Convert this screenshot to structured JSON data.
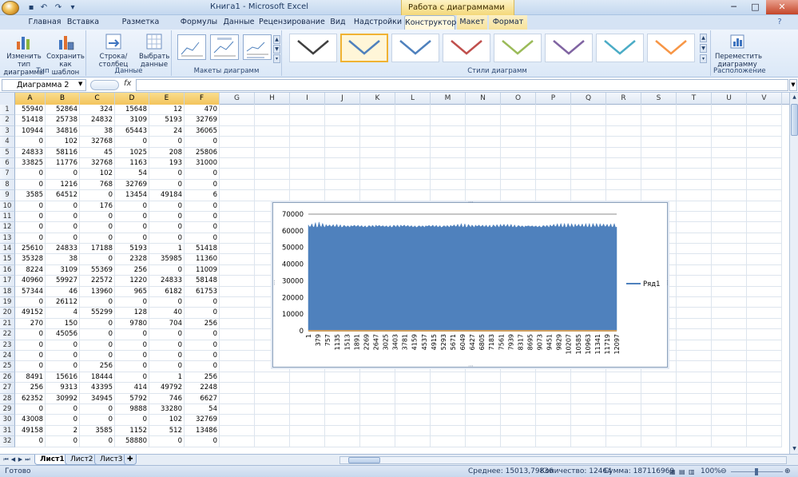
{
  "window": {
    "title": "Книга1 - Microsoft Excel",
    "context_title": "Работа с диаграммами",
    "controls": {
      "minimize": "─",
      "maximize": "□",
      "close": "✕"
    }
  },
  "ribbon_tabs": [
    "Главная",
    "Вставка",
    "Разметка страницы",
    "Формулы",
    "Данные",
    "Рецензирование",
    "Вид",
    "Надстройки",
    "Конструктор",
    "Макет",
    "Формат"
  ],
  "active_tab": "Конструктор",
  "ribbon": {
    "groups": {
      "type": "Тип",
      "data": "Данные",
      "layouts": "Макеты диаграмм",
      "styles": "Стили диаграмм",
      "placement": "Расположение"
    },
    "buttons": {
      "change_type": "Изменить тип диаграммы",
      "save_template": "Сохранить как шаблон",
      "row_col": "Строка/столбец",
      "select_data": "Выбрать данные",
      "move_chart": "Переместить диаграмму"
    },
    "style_colors": [
      "#404040",
      "#4f81bd",
      "#4f81bd",
      "#c0504d",
      "#9bbb59",
      "#8064a2",
      "#4bacc6",
      "#f79646"
    ]
  },
  "formula_bar": {
    "name_box": "Диаграмма 2",
    "fx": "fx",
    "value": ""
  },
  "columns": [
    "A",
    "B",
    "C",
    "D",
    "E",
    "F",
    "G",
    "H",
    "I",
    "J",
    "K",
    "L",
    "M",
    "N",
    "O",
    "P",
    "Q",
    "R",
    "S",
    "T",
    "U",
    "V"
  ],
  "highlighted_columns": [
    "A",
    "B",
    "C",
    "D",
    "E",
    "F"
  ],
  "rows": [
    {
      "n": "1",
      "cells": [
        "55940",
        "52864",
        "324",
        "15648",
        "12",
        "470"
      ]
    },
    {
      "n": "2",
      "cells": [
        "51418",
        "25738",
        "24832",
        "3109",
        "5193",
        "32769"
      ]
    },
    {
      "n": "3",
      "cells": [
        "10944",
        "34816",
        "38",
        "65443",
        "24",
        "36065"
      ]
    },
    {
      "n": "4",
      "cells": [
        "0",
        "102",
        "32768",
        "0",
        "0",
        "0"
      ]
    },
    {
      "n": "5",
      "cells": [
        "24833",
        "58116",
        "45",
        "1025",
        "208",
        "25806"
      ]
    },
    {
      "n": "6",
      "cells": [
        "33825",
        "11776",
        "32768",
        "1163",
        "193",
        "31000"
      ]
    },
    {
      "n": "7",
      "cells": [
        "0",
        "0",
        "102",
        "54",
        "0",
        "0"
      ]
    },
    {
      "n": "8",
      "cells": [
        "0",
        "1216",
        "768",
        "32769",
        "0",
        "0"
      ]
    },
    {
      "n": "9",
      "cells": [
        "3585",
        "64512",
        "0",
        "13454",
        "49184",
        "6"
      ]
    },
    {
      "n": "10",
      "cells": [
        "0",
        "0",
        "176",
        "0",
        "0",
        "0"
      ]
    },
    {
      "n": "11",
      "cells": [
        "0",
        "0",
        "0",
        "0",
        "0",
        "0"
      ]
    },
    {
      "n": "12",
      "cells": [
        "0",
        "0",
        "0",
        "0",
        "0",
        "0"
      ]
    },
    {
      "n": "13",
      "cells": [
        "0",
        "0",
        "0",
        "0",
        "0",
        "0"
      ]
    },
    {
      "n": "14",
      "cells": [
        "25610",
        "24833",
        "17188",
        "5193",
        "1",
        "51418"
      ]
    },
    {
      "n": "15",
      "cells": [
        "35328",
        "38",
        "0",
        "2328",
        "35985",
        "11360"
      ]
    },
    {
      "n": "16",
      "cells": [
        "8224",
        "3109",
        "55369",
        "256",
        "0",
        "11009"
      ]
    },
    {
      "n": "17",
      "cells": [
        "40960",
        "59927",
        "22572",
        "1220",
        "24833",
        "58148"
      ]
    },
    {
      "n": "18",
      "cells": [
        "57344",
        "46",
        "13960",
        "965",
        "6182",
        "61753"
      ]
    },
    {
      "n": "19",
      "cells": [
        "0",
        "26112",
        "0",
        "0",
        "0",
        "0"
      ]
    },
    {
      "n": "20",
      "cells": [
        "49152",
        "4",
        "55299",
        "128",
        "40",
        "0"
      ]
    },
    {
      "n": "21",
      "cells": [
        "270",
        "150",
        "0",
        "9780",
        "704",
        "256"
      ]
    },
    {
      "n": "22",
      "cells": [
        "0",
        "45056",
        "0",
        "0",
        "0",
        "0"
      ]
    },
    {
      "n": "23",
      "cells": [
        "0",
        "0",
        "0",
        "0",
        "0",
        "0"
      ]
    },
    {
      "n": "24",
      "cells": [
        "0",
        "0",
        "0",
        "0",
        "0",
        "0"
      ]
    },
    {
      "n": "25",
      "cells": [
        "0",
        "0",
        "256",
        "0",
        "0",
        "0"
      ]
    },
    {
      "n": "26",
      "cells": [
        "8491",
        "15616",
        "18444",
        "0",
        "1",
        "256"
      ]
    },
    {
      "n": "27",
      "cells": [
        "256",
        "9313",
        "43395",
        "414",
        "49792",
        "2248"
      ]
    },
    {
      "n": "28",
      "cells": [
        "62352",
        "30992",
        "34945",
        "5792",
        "746",
        "6627"
      ]
    },
    {
      "n": "29",
      "cells": [
        "0",
        "0",
        "0",
        "9888",
        "33280",
        "54"
      ]
    },
    {
      "n": "30",
      "cells": [
        "43008",
        "0",
        "0",
        "0",
        "102",
        "32769"
      ]
    },
    {
      "n": "31",
      "cells": [
        "49158",
        "2",
        "3585",
        "1152",
        "512",
        "13486"
      ]
    },
    {
      "n": "32",
      "cells": [
        "0",
        "0",
        "0",
        "58880",
        "0",
        "0"
      ]
    }
  ],
  "sheet_tabs": [
    "Лист1",
    "Лист2",
    "Лист3"
  ],
  "active_sheet": "Лист1",
  "status": {
    "ready": "Готово",
    "average": "Среднее: 15013,79836",
    "count": "Количество: 12464",
    "sum": "Сумма: 187116969",
    "zoom": "100%"
  },
  "chart_data": {
    "type": "area",
    "title": "",
    "xlabel": "",
    "ylabel": "",
    "ylim": [
      0,
      70000
    ],
    "yticks": [
      0,
      10000,
      20000,
      30000,
      40000,
      50000,
      60000,
      70000
    ],
    "x_tick_labels": [
      "1",
      "379",
      "757",
      "1135",
      "1513",
      "1891",
      "2269",
      "2647",
      "3025",
      "3403",
      "3781",
      "4159",
      "4537",
      "4915",
      "5293",
      "5671",
      "6049",
      "6427",
      "6805",
      "7183",
      "7561",
      "7939",
      "8317",
      "8695",
      "9073",
      "9451",
      "9829",
      "10207",
      "10585",
      "10963",
      "11341",
      "11719",
      "12097"
    ],
    "series": [
      {
        "name": "Ряд1",
        "color": "#4f81bd",
        "n_points": 12464,
        "typical_value": 62000,
        "envelope_max_at_ticks": [
          63500,
          65500,
          63500,
          64000,
          63000,
          63500,
          63000,
          63500,
          63000,
          63500,
          63500,
          63000,
          63000,
          63500,
          63000,
          63500,
          64500,
          63500,
          63500,
          63500,
          64000,
          64000,
          63000,
          63000,
          63000,
          63500,
          64500,
          64500,
          64000,
          64500,
          64500,
          64000,
          64500
        ]
      }
    ],
    "legend": "right",
    "grid": true
  }
}
